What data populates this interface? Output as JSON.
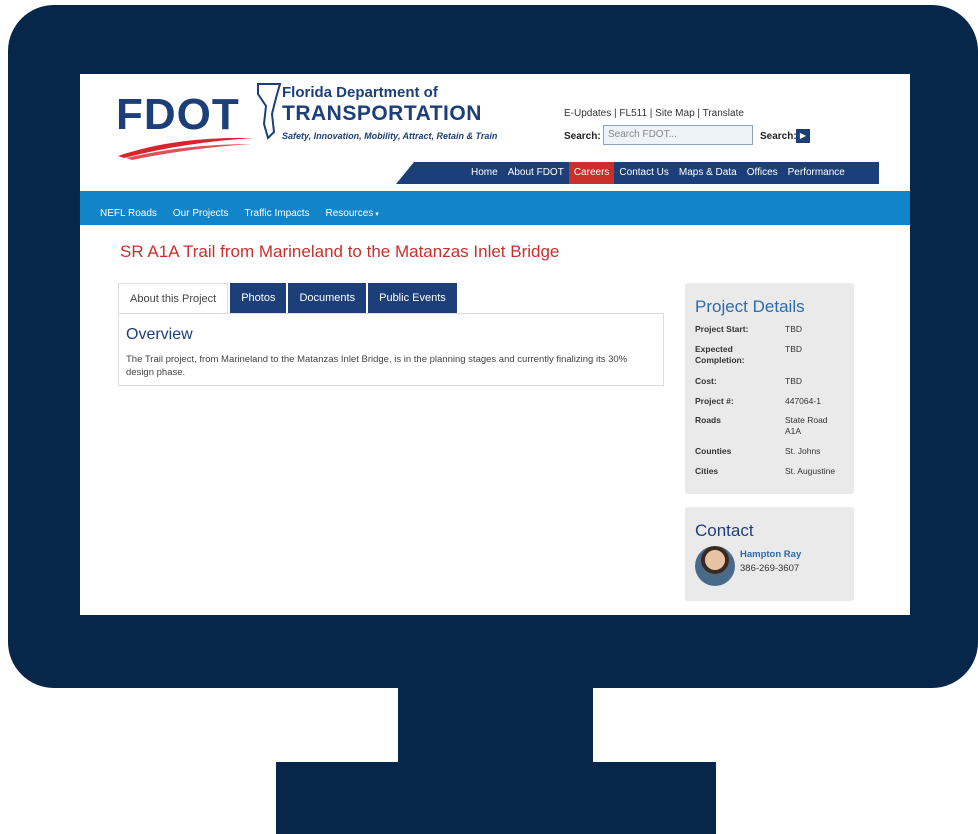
{
  "header": {
    "logo_text": "FDOT",
    "logo_line1": "Florida Department of",
    "logo_line2": "TRANSPORTATION",
    "tagline": "Safety, Innovation, Mobility, Attract, Retain & Train",
    "top_links": "E-Updates | FL511 | Site Map | Translate",
    "search_label": "Search:",
    "search_placeholder": "Search FDOT...",
    "search_button_label": "Search:"
  },
  "top_nav": [
    {
      "label": "Home"
    },
    {
      "label": "About FDOT"
    },
    {
      "label": "Careers"
    },
    {
      "label": "Contact Us"
    },
    {
      "label": "Maps & Data"
    },
    {
      "label": "Offices"
    },
    {
      "label": "Performance"
    }
  ],
  "sub_nav": [
    {
      "label": "NEFL Roads"
    },
    {
      "label": "Our Projects"
    },
    {
      "label": "Traffic Impacts"
    },
    {
      "label": "Resources"
    }
  ],
  "page_title": "SR A1A Trail from Marineland to the Matanzas Inlet Bridge",
  "tabs": [
    {
      "label": "About this Project"
    },
    {
      "label": "Photos"
    },
    {
      "label": "Documents"
    },
    {
      "label": "Public Events"
    }
  ],
  "overview": {
    "heading": "Overview",
    "text": "The Trail project, from Marineland to the Matanzas Inlet Bridge, is in the planning stages and currently finalizing its 30% design phase."
  },
  "project_details": {
    "heading": "Project Details",
    "rows": [
      {
        "key": "Project Start:",
        "value": "TBD"
      },
      {
        "key": "Expected Completion:",
        "value": "TBD"
      },
      {
        "key": "Cost:",
        "value": "TBD"
      },
      {
        "key": "Project #:",
        "value": "447064-1"
      },
      {
        "key": "Roads",
        "value": "State Road A1A"
      },
      {
        "key": "Counties",
        "value": "St. Johns"
      },
      {
        "key": "Cities",
        "value": "St. Augustine"
      }
    ]
  },
  "contact": {
    "heading": "Contact",
    "name": "Hampton Ray",
    "phone": "386-269-3607"
  },
  "colors": {
    "monitor": "#06264a",
    "brand_blue": "#1c3f7a",
    "sub_nav": "#1185c8",
    "accent_red": "#c9302c"
  }
}
